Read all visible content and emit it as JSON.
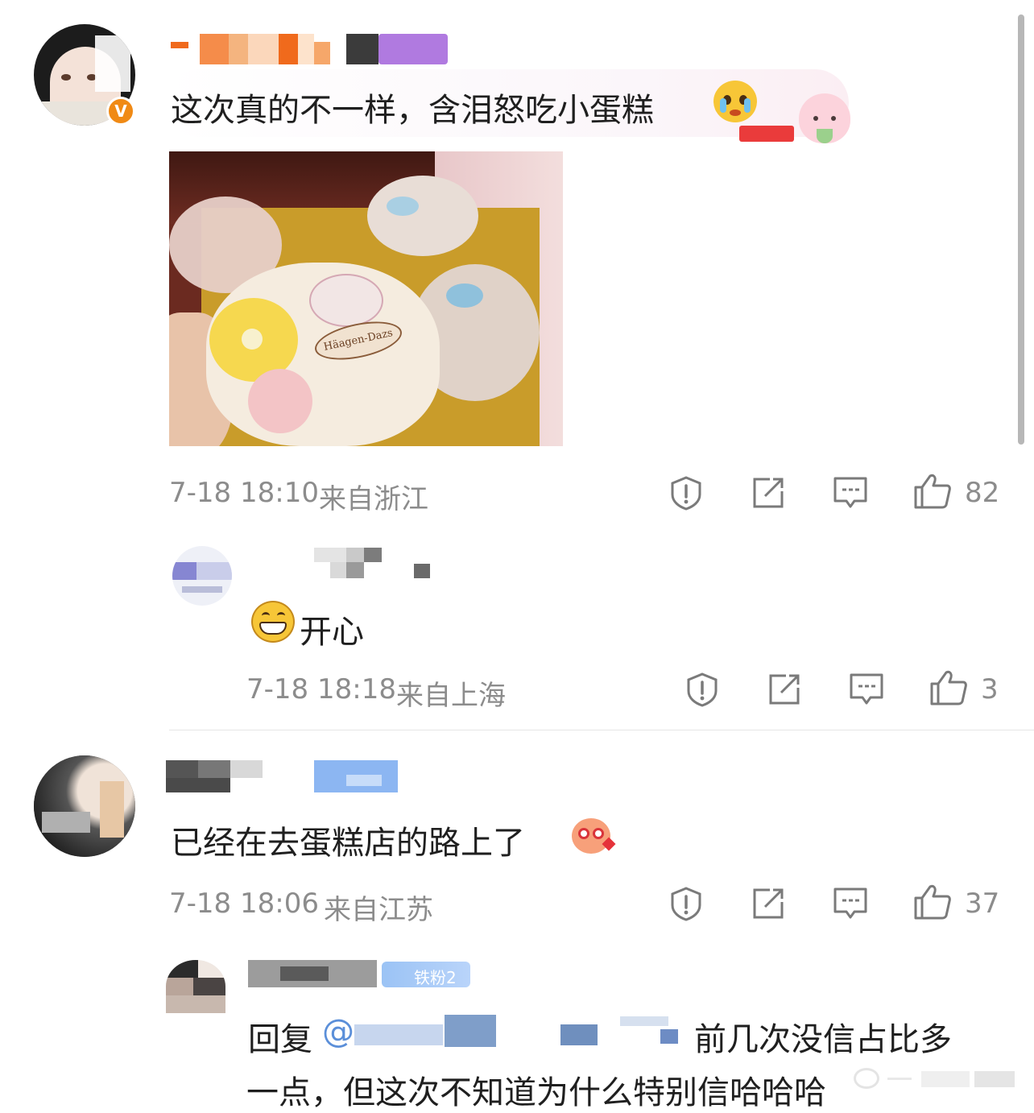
{
  "comments": [
    {
      "text": "这次真的不一样，含泪怒吃小蛋糕",
      "time": "7-18 18:10",
      "location": "来自浙江",
      "likes": "82",
      "image_brand": "Häagen-Dazs",
      "emoji": "crying-face"
    },
    {
      "text": "开心",
      "time": "7-18 18:18",
      "location": "来自上海",
      "likes": "3",
      "emoji": "grinning-face"
    },
    {
      "text": "已经在去蛋糕店的路上了",
      "time": "7-18 18:06",
      "location": "来自江苏",
      "likes": "37",
      "emoji": "heart-eyes-sticker"
    },
    {
      "reply_prefix": "回复",
      "reply_at": "@",
      "text_line1": "前几次没信占比多",
      "text_line2": "一点，但这次不知道为什么特别信哈哈哈",
      "badge": "铁粉2"
    }
  ],
  "icons": {
    "report": "report-icon",
    "share": "share-icon",
    "reply": "comment-icon",
    "like": "like-icon"
  },
  "colors": {
    "meta": "#8c8c8c",
    "text": "#1f1f1f",
    "icon": "#7a7a7a",
    "verified": "#f08a15"
  }
}
